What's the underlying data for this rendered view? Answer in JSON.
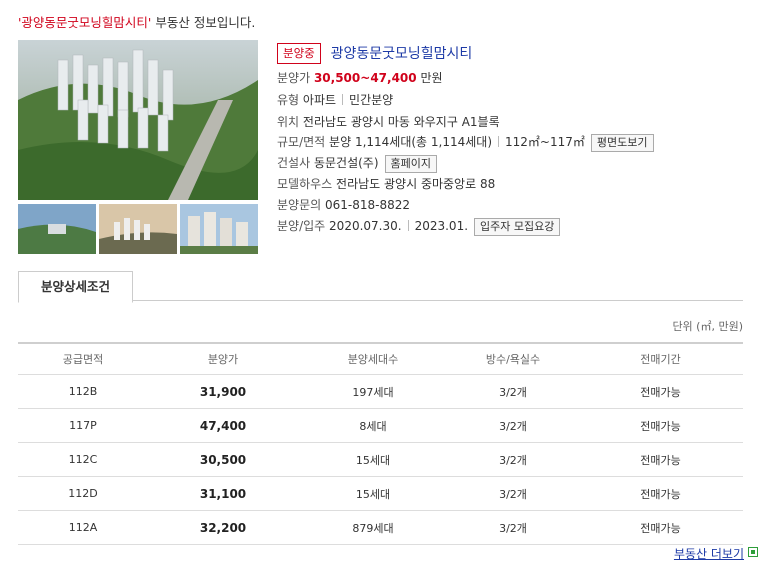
{
  "heading": {
    "quoted": "'광양동문굿모닝힐맘시티'",
    "suffix": "부동산 정보입니다."
  },
  "listing": {
    "status_badge": "분양중",
    "title": "광양동문굿모닝힐맘시티",
    "price_label": "분양가",
    "price_value": "30,500~47,400",
    "price_unit": "만원",
    "type_label": "유형",
    "type_value1": "아파트",
    "type_value2": "민간분양",
    "location_label": "위치",
    "location_value": "전라남도 광양시 마동 와우지구 A1블록",
    "scale_label": "규모/면적",
    "scale_value": "분양 1,114세대(총 1,114세대)",
    "area_value": "112㎡~117㎡",
    "floorplan_button": "평면도보기",
    "builder_label": "건설사",
    "builder_value": "동문건설(주)",
    "homepage_button": "홈페이지",
    "modelhouse_label": "모델하우스",
    "modelhouse_value": "전라남도 광양시 중마중앙로 88",
    "inquiry_label": "분양문의",
    "inquiry_value": "061-818-8822",
    "dates_label": "분양/입주",
    "sale_date": "2020.07.30.",
    "move_date": "2023.01.",
    "notice_button": "입주자 모집요강"
  },
  "tabs": {
    "active": "분양상세조건"
  },
  "unit_note": "단위 (㎡, 만원)",
  "table": {
    "headers": [
      "공급면적",
      "분양가",
      "분양세대수",
      "방수/욕실수",
      "전매기간"
    ],
    "rows": [
      [
        "112B",
        "31,900",
        "197세대",
        "3/2개",
        "전매가능"
      ],
      [
        "117P",
        "47,400",
        "8세대",
        "3/2개",
        "전매가능"
      ],
      [
        "112C",
        "30,500",
        "15세대",
        "3/2개",
        "전매가능"
      ],
      [
        "112D",
        "31,100",
        "15세대",
        "3/2개",
        "전매가능"
      ],
      [
        "112A",
        "32,200",
        "879세대",
        "3/2개",
        "전매가능"
      ]
    ]
  },
  "more_link": "부동산 더보기",
  "colors": {
    "accent_red": "#d0021b",
    "link_blue": "#1d3aa6",
    "icon_green": "#2e9e3a"
  }
}
